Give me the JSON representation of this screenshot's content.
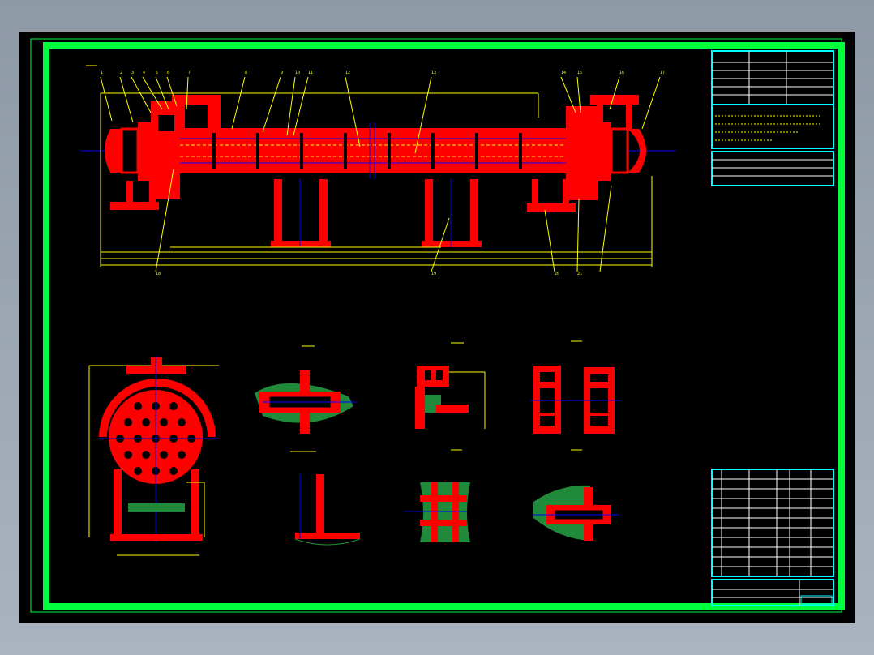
{
  "drawing": {
    "background_color": "#000000",
    "border_color": "#00ff3c",
    "part_color": "#ff0000",
    "centerline_color": "#0000ff",
    "dimension_color": "#ffff00",
    "table_color": "#00ffff",
    "hatch_color": "#1f8a3a"
  },
  "balloons": [
    "1",
    "2",
    "3",
    "4",
    "5",
    "6",
    "7",
    "8",
    "9",
    "10",
    "11",
    "12",
    "13",
    "14",
    "15",
    "16",
    "17",
    "18",
    "19",
    "20",
    "21"
  ],
  "icons": [
    "shell-and-tube-exchanger-elevation",
    "end-section-view",
    "detail-view-a",
    "detail-view-b",
    "detail-view-c",
    "detail-view-d",
    "detail-view-e",
    "detail-view-f",
    "title-block",
    "parts-list",
    "technical-specification-table"
  ]
}
